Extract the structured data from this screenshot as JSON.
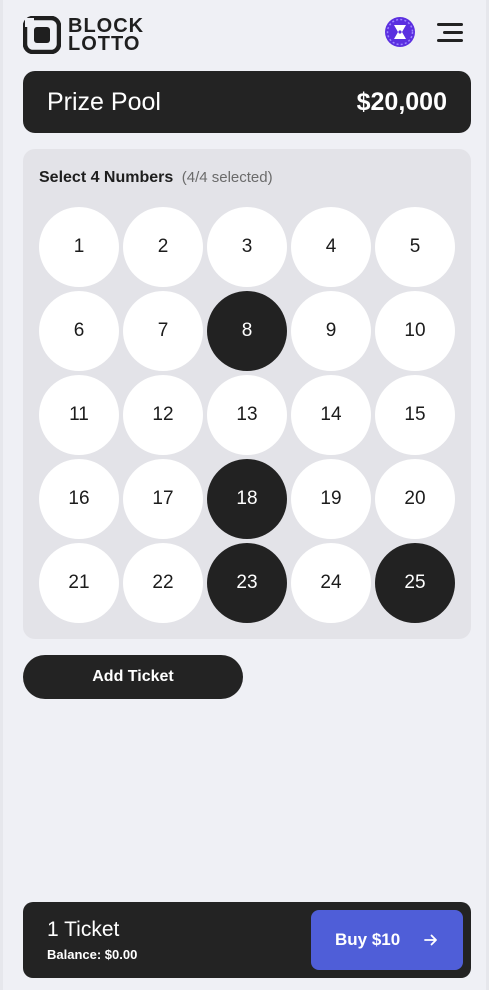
{
  "header": {
    "logo_line1": "BLOCK",
    "logo_line2": "LOTTO",
    "avatar_icon": "wallet-avatar-icon",
    "menu_icon": "hamburger-menu-icon"
  },
  "prize_pool": {
    "label": "Prize Pool",
    "value": "$20,000"
  },
  "picker": {
    "title": "Select 4 Numbers",
    "count": "(4/4 selected)",
    "numbers": [
      1,
      2,
      3,
      4,
      5,
      6,
      7,
      8,
      9,
      10,
      11,
      12,
      13,
      14,
      15,
      16,
      17,
      18,
      19,
      20,
      21,
      22,
      23,
      24,
      25
    ],
    "selected": [
      8,
      18,
      23,
      25
    ]
  },
  "actions": {
    "add_ticket": "Add Ticket"
  },
  "footer": {
    "tickets": "1 Ticket",
    "balance": "Balance: $0.00",
    "buy_label": "Buy $10",
    "buy_icon": "arrow-right-icon"
  },
  "colors": {
    "background": "#eff0f5",
    "dark": "#232323",
    "accent": "#4f5ed8",
    "avatar": "#5b2fe0"
  }
}
